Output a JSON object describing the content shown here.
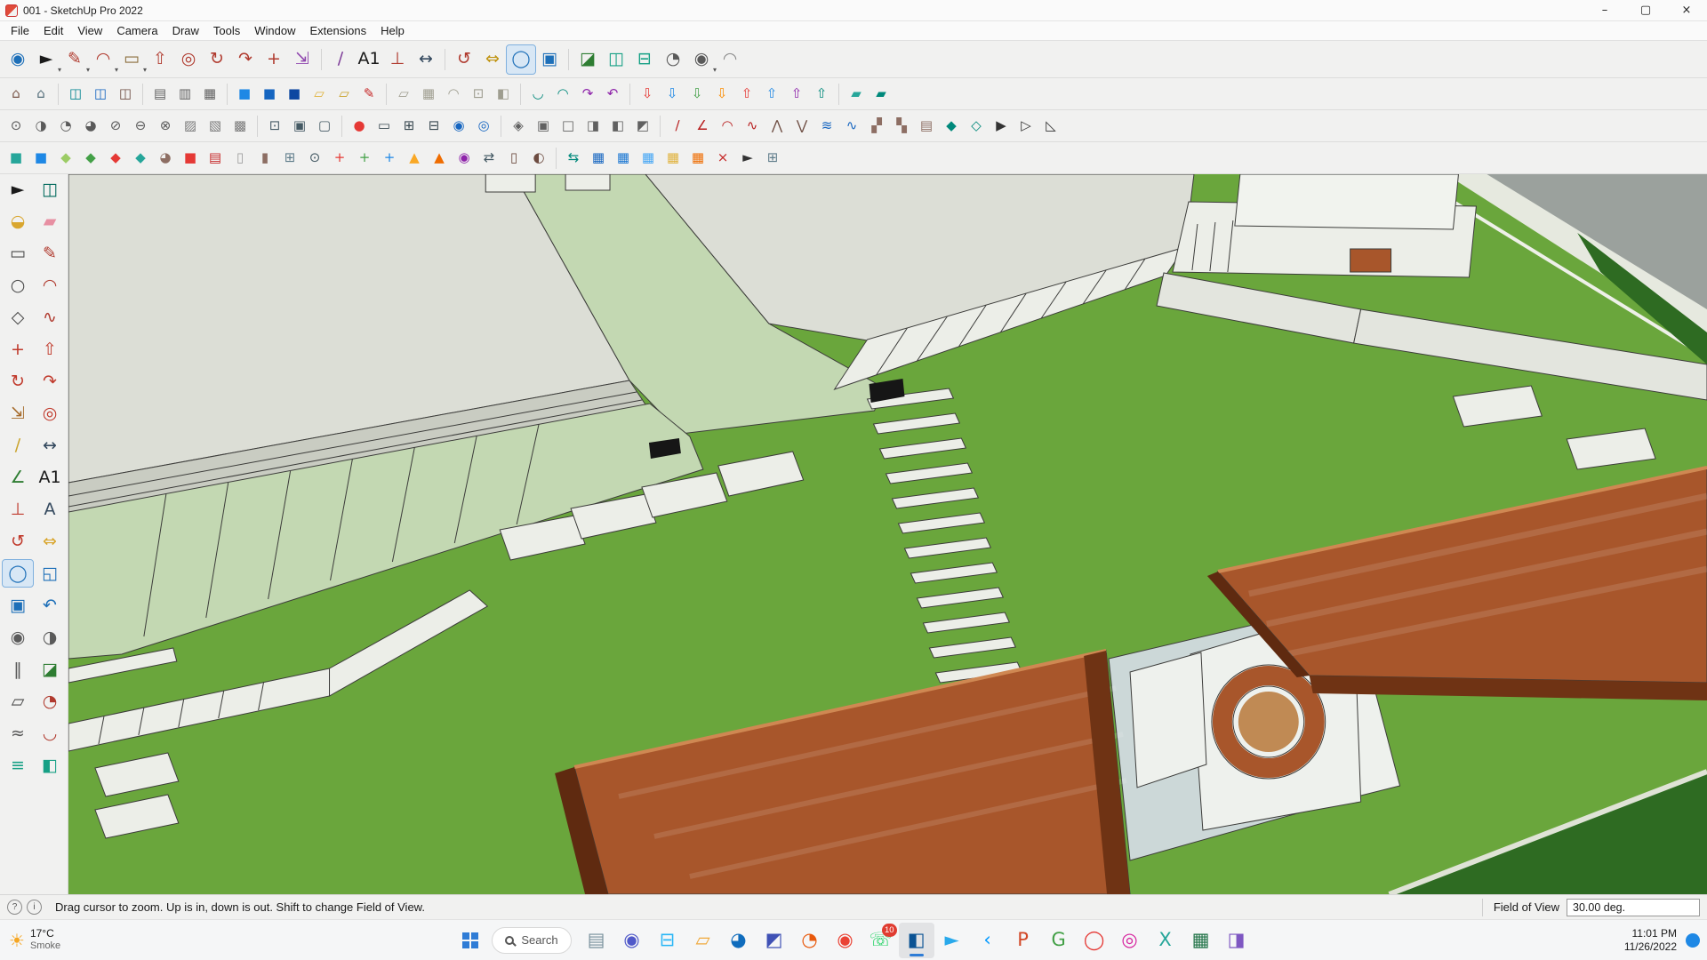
{
  "window": {
    "title": "001 - SketchUp Pro 2022",
    "controls": {
      "minimize": "–",
      "maximize": "▢",
      "close": "×"
    }
  },
  "menu": {
    "items": [
      {
        "n": "menu-file",
        "label": "File"
      },
      {
        "n": "menu-edit",
        "label": "Edit"
      },
      {
        "n": "menu-view",
        "label": "View"
      },
      {
        "n": "menu-camera",
        "label": "Camera"
      },
      {
        "n": "menu-draw",
        "label": "Draw"
      },
      {
        "n": "menu-tools",
        "label": "Tools"
      },
      {
        "n": "menu-window",
        "label": "Window"
      },
      {
        "n": "menu-extensions",
        "label": "Extensions"
      },
      {
        "n": "menu-help",
        "label": "Help"
      }
    ]
  },
  "toolbars": {
    "dropdown_glyph": "▾",
    "row1": [
      {
        "n": "zoom-window-tool",
        "g": "◉",
        "c": "#1d6fb8"
      },
      {
        "n": "select-tool",
        "g": "►",
        "c": "#1a1a1a",
        "dd": true
      },
      {
        "n": "line-tool",
        "g": "✎",
        "c": "#b03a2e",
        "dd": true
      },
      {
        "n": "arc-tool",
        "g": "◠",
        "c": "#b03a2e",
        "dd": true
      },
      {
        "n": "rectangle-tool",
        "g": "▭",
        "c": "#8a6d3b",
        "dd": true
      },
      {
        "n": "push-pull-tool",
        "g": "⇧",
        "c": "#b03a2e"
      },
      {
        "n": "offset-tool",
        "g": "◎",
        "c": "#b03a2e"
      },
      {
        "n": "rotate-tool",
        "g": "↻",
        "c": "#b03a2e"
      },
      {
        "n": "follow-me-tool",
        "g": "↷",
        "c": "#b03a2e"
      },
      {
        "n": "move-tool",
        "g": "+",
        "c": "#b03a2e"
      },
      {
        "n": "scale-tool",
        "g": "⇲",
        "c": "#8e44ad"
      },
      {
        "sep": true
      },
      {
        "n": "tape-measure-tool",
        "g": "∕",
        "c": "#7d3c98"
      },
      {
        "n": "text-tool",
        "g": "A1",
        "c": "#1a1a1a"
      },
      {
        "n": "axes-tool",
        "g": "⊥",
        "c": "#b03a2e"
      },
      {
        "n": "dimension-tool",
        "g": "↔",
        "c": "#34495e"
      },
      {
        "sep": true
      },
      {
        "n": "orbit-tool",
        "g": "↺",
        "c": "#b03a2e"
      },
      {
        "n": "pan-tool",
        "g": "⇔",
        "c": "#c09412"
      },
      {
        "n": "zoom-tool",
        "g": "◯",
        "c": "#1d6fb8",
        "active": true
      },
      {
        "n": "zoom-extents-tool",
        "g": "▣",
        "c": "#1d6fb8"
      },
      {
        "sep": true
      },
      {
        "n": "section-plane-tool",
        "g": "◪",
        "c": "#2e7d32"
      },
      {
        "n": "section-display-toggle",
        "g": "◫",
        "c": "#16a085"
      },
      {
        "n": "section-cut-toggle",
        "g": "⊟",
        "c": "#16a085"
      },
      {
        "n": "search-extensions-icon",
        "g": "◔",
        "c": "#5a5a5a"
      },
      {
        "n": "user-profile-button",
        "g": "◉",
        "c": "#5a5a5a",
        "dd": true
      },
      {
        "n": "look-around-tool",
        "g": "◠",
        "c": "#8a8a8a"
      }
    ],
    "row2": [
      {
        "n": "3d-warehouse-icon",
        "g": "⌂",
        "c": "#795548"
      },
      {
        "n": "extension-warehouse-icon",
        "g": "⌂",
        "c": "#546e7a"
      },
      {
        "sep": true
      },
      {
        "n": "make-component-icon",
        "g": "◫",
        "c": "#00838f"
      },
      {
        "n": "edit-component-icon",
        "g": "◫",
        "c": "#1565c0"
      },
      {
        "n": "lock-component-icon",
        "g": "◫",
        "c": "#6d4c41"
      },
      {
        "sep": true
      },
      {
        "n": "entity-info-panel-icon",
        "g": "▤",
        "c": "#616161"
      },
      {
        "n": "materials-panel-icon",
        "g": "▥",
        "c": "#616161"
      },
      {
        "n": "styles-panel-icon",
        "g": "▦",
        "c": "#616161"
      },
      {
        "sep": true
      },
      {
        "n": "solid-union-icon",
        "g": "■",
        "c": "#1e88e5"
      },
      {
        "n": "solid-subtract-icon",
        "g": "■",
        "c": "#1565c0"
      },
      {
        "n": "solid-intersect-icon",
        "g": "■",
        "c": "#0d47a1"
      },
      {
        "n": "label-icon",
        "g": "▱",
        "c": "#e0b23c"
      },
      {
        "n": "flag-note-icon",
        "g": "▱",
        "c": "#c9a227"
      },
      {
        "n": "marker-icon",
        "g": "✎",
        "c": "#c62828"
      },
      {
        "sep": true
      },
      {
        "n": "sandbox-from-contours-icon",
        "g": "▱",
        "c": "#9e9d8f"
      },
      {
        "n": "sandbox-from-scratch-icon",
        "g": "▦",
        "c": "#9e9d8f"
      },
      {
        "n": "smoove-icon",
        "g": "◠",
        "c": "#9e9d8f"
      },
      {
        "n": "stamp-icon",
        "g": "⊡",
        "c": "#9e9d8f"
      },
      {
        "n": "drape-icon",
        "g": "◧",
        "c": "#9e9d8f"
      },
      {
        "sep": true
      },
      {
        "n": "weld-edges-icon",
        "g": "◡",
        "c": "#00897b"
      },
      {
        "n": "curve-tool-icon",
        "g": "◠",
        "c": "#00897b"
      },
      {
        "n": "follow-path-icon",
        "g": "↷",
        "c": "#8e24aa"
      },
      {
        "n": "reverse-path-icon",
        "g": "↶",
        "c": "#8e24aa"
      },
      {
        "sep": true
      },
      {
        "n": "drop-vertices-red-icon",
        "g": "⇩",
        "c": "#e53935"
      },
      {
        "n": "drop-vertices-blue-icon",
        "g": "⇩",
        "c": "#1e88e5"
      },
      {
        "n": "drop-vertices-green-icon",
        "g": "⇩",
        "c": "#43a047"
      },
      {
        "n": "drop-vertices-orange-icon",
        "g": "⇩",
        "c": "#fb8c00"
      },
      {
        "n": "raise-vertices-red-icon",
        "g": "⇧",
        "c": "#e53935"
      },
      {
        "n": "raise-vertices-blue-icon",
        "g": "⇧",
        "c": "#1e88e5"
      },
      {
        "n": "raise-vertices-purple-icon",
        "g": "⇧",
        "c": "#8e24aa"
      },
      {
        "n": "raise-vertices-teal-icon",
        "g": "⇧",
        "c": "#00897b"
      },
      {
        "sep": true
      },
      {
        "n": "toposhaper-icon",
        "g": "▰",
        "c": "#26a69a"
      },
      {
        "n": "quad-face-tools-icon",
        "g": "▰",
        "c": "#00897b"
      }
    ],
    "row3": [
      {
        "n": "shaded-with-textures-icon",
        "g": "⊙",
        "c": "#5a5a5a"
      },
      {
        "n": "shaded-icon",
        "g": "◑",
        "c": "#5a5a5a"
      },
      {
        "n": "hidden-line-icon",
        "g": "◔",
        "c": "#5a5a5a"
      },
      {
        "n": "wireframe-icon",
        "g": "◕",
        "c": "#5a5a5a"
      },
      {
        "n": "xray-icon",
        "g": "⊘",
        "c": "#5a5a5a"
      },
      {
        "n": "monochrome-icon",
        "g": "⊖",
        "c": "#5a5a5a"
      },
      {
        "n": "back-edges-icon",
        "g": "⊗",
        "c": "#5a5a5a"
      },
      {
        "n": "texture-a-icon",
        "g": "▨",
        "c": "#7a7a7a"
      },
      {
        "n": "texture-b-icon",
        "g": "▧",
        "c": "#7a7a7a"
      },
      {
        "n": "texture-c-icon",
        "g": "▩",
        "c": "#7a7a7a"
      },
      {
        "sep": true
      },
      {
        "n": "shadow-settings-icon",
        "g": "⊡",
        "c": "#455a64"
      },
      {
        "n": "shadows-toggle-icon",
        "g": "▣",
        "c": "#455a64"
      },
      {
        "n": "fog-toggle-icon",
        "g": "▢",
        "c": "#455a64"
      },
      {
        "sep": true
      },
      {
        "n": "scene-record-icon",
        "g": "●",
        "c": "#e53935"
      },
      {
        "n": "monitor-icon",
        "g": "▭",
        "c": "#37474f"
      },
      {
        "n": "film-icon",
        "g": "⊞",
        "c": "#37474f"
      },
      {
        "n": "export-frame-icon",
        "g": "⊟",
        "c": "#37474f"
      },
      {
        "n": "camera-previous-icon",
        "g": "◉",
        "c": "#1565c0"
      },
      {
        "n": "camera-next-icon",
        "g": "◎",
        "c": "#1565c0"
      },
      {
        "sep": true
      },
      {
        "n": "iso-view-icon",
        "g": "◈",
        "c": "#616161"
      },
      {
        "n": "top-view-icon",
        "g": "▣",
        "c": "#616161"
      },
      {
        "n": "front-view-icon",
        "g": "□",
        "c": "#616161"
      },
      {
        "n": "right-view-icon",
        "g": "◨",
        "c": "#616161"
      },
      {
        "n": "back-view-icon",
        "g": "◧",
        "c": "#616161"
      },
      {
        "n": "left-view-icon",
        "g": "◩",
        "c": "#616161"
      },
      {
        "sep": true
      },
      {
        "n": "line-2pt-icon",
        "g": "∕",
        "c": "#b71c1c"
      },
      {
        "n": "angle-tool-icon",
        "g": "∠",
        "c": "#b71c1c"
      },
      {
        "n": "arc-3pt-icon",
        "g": "◠",
        "c": "#b71c1c"
      },
      {
        "n": "bezier-icon",
        "g": "∿",
        "c": "#b71c1c"
      },
      {
        "n": "vertex-edit-icon",
        "g": "⋀",
        "c": "#6d4c41"
      },
      {
        "n": "edge-split-icon",
        "g": "⋁",
        "c": "#6d4c41"
      },
      {
        "n": "waves-icon",
        "g": "≋",
        "c": "#1565c0"
      },
      {
        "n": "contour-icon",
        "g": "∿",
        "c": "#1565c0"
      },
      {
        "n": "hatch-ne-icon",
        "g": "▞",
        "c": "#8d6e63"
      },
      {
        "n": "hatch-nw-icon",
        "g": "▚",
        "c": "#8d6e63"
      },
      {
        "n": "board-icon",
        "g": "▤",
        "c": "#8d6e63"
      },
      {
        "n": "gem-icon",
        "g": "◆",
        "c": "#00897b"
      },
      {
        "n": "gem-outline-icon",
        "g": "◇",
        "c": "#00897b"
      },
      {
        "n": "play-icon",
        "g": "▶",
        "c": "#333333"
      },
      {
        "n": "select-arrow-icon",
        "g": "▷",
        "c": "#333333"
      },
      {
        "n": "wedge-icon",
        "g": "◺",
        "c": "#333333"
      }
    ],
    "row4": [
      {
        "n": "tags-panel-icon",
        "g": "■",
        "c": "#26a69a"
      },
      {
        "n": "outliner-panel-icon",
        "g": "■",
        "c": "#1e88e5"
      },
      {
        "n": "scenes-panel-icon",
        "g": "◆",
        "c": "#9ccc65"
      },
      {
        "n": "instructor-icon",
        "g": "◆",
        "c": "#43a047"
      },
      {
        "n": "settings-diamond-icon",
        "g": "◆",
        "c": "#e53935"
      },
      {
        "n": "preferences-icon",
        "g": "◆",
        "c": "#26a69a"
      },
      {
        "n": "donut-icon",
        "g": "◕",
        "c": "#8d6e63"
      },
      {
        "n": "material-red-icon",
        "g": "■",
        "c": "#e53935"
      },
      {
        "n": "book-icon",
        "g": "▤",
        "c": "#c62828"
      },
      {
        "n": "page-icon",
        "g": "▯",
        "c": "#9e9e9e"
      },
      {
        "n": "wood-sample-icon",
        "g": "▮",
        "c": "#8d6e63"
      },
      {
        "n": "link-icon",
        "g": "⊞",
        "c": "#607d8b"
      },
      {
        "n": "node-edit-icon",
        "g": "⊙",
        "c": "#455a64"
      },
      {
        "n": "add-red-icon",
        "g": "+",
        "c": "#e53935"
      },
      {
        "n": "add-green-icon",
        "g": "+",
        "c": "#43a047"
      },
      {
        "n": "add-blue-icon",
        "g": "+",
        "c": "#1e88e5"
      },
      {
        "n": "pyramid-icon",
        "g": "▲",
        "c": "#f9a825"
      },
      {
        "n": "cone-icon",
        "g": "▲",
        "c": "#ef6c00"
      },
      {
        "n": "droplet-icon",
        "g": "◉",
        "c": "#8e24aa"
      },
      {
        "n": "mirror-icon",
        "g": "⇄",
        "c": "#455a64"
      },
      {
        "n": "bin-icon",
        "g": "▯",
        "c": "#6d4c41"
      },
      {
        "n": "paint-half-icon",
        "g": "◐",
        "c": "#6d4c41"
      },
      {
        "sep": true
      },
      {
        "n": "component-swap-icon",
        "g": "⇆",
        "c": "#00897b"
      },
      {
        "n": "grid-blue-a-icon",
        "g": "▦",
        "c": "#1565c0"
      },
      {
        "n": "grid-blue-b-icon",
        "g": "▦",
        "c": "#1976d2"
      },
      {
        "n": "grid-blue-c-icon",
        "g": "▦",
        "c": "#42a5f5"
      },
      {
        "n": "grid-yellow-icon",
        "g": "▦",
        "c": "#e0b23c"
      },
      {
        "n": "grid-orange-icon",
        "g": "▦",
        "c": "#ef6c00"
      },
      {
        "n": "delete-icon",
        "g": "×",
        "c": "#c62828"
      },
      {
        "n": "cursor-icon",
        "g": "►",
        "c": "#333333"
      },
      {
        "n": "layout-grid-icon",
        "g": "⊞",
        "c": "#607d8b"
      }
    ]
  },
  "palette": [
    {
      "n": "select-tool",
      "g": "►",
      "c": "#1a1a1a"
    },
    {
      "n": "make-component-tool",
      "g": "◫",
      "c": "#00695c"
    },
    {
      "n": "paint-bucket-tool",
      "g": "◒",
      "c": "#d9a62e"
    },
    {
      "n": "eraser-tool",
      "g": "▰",
      "c": "#e78fa2"
    },
    {
      "n": "rectangle-tool",
      "g": "▭",
      "c": "#4a4a4a"
    },
    {
      "n": "line-tool",
      "g": "✎",
      "c": "#b03a2e"
    },
    {
      "n": "circle-tool",
      "g": "○",
      "c": "#4a4a4a"
    },
    {
      "n": "arc-tool",
      "g": "◠",
      "c": "#b03a2e"
    },
    {
      "n": "polygon-tool",
      "g": "◇",
      "c": "#4a4a4a"
    },
    {
      "n": "freehand-tool",
      "g": "∿",
      "c": "#b03a2e"
    },
    {
      "n": "move-tool",
      "g": "+",
      "c": "#c0392b"
    },
    {
      "n": "push-pull-tool",
      "g": "⇧",
      "c": "#c0392b"
    },
    {
      "n": "rotate-tool",
      "g": "↻",
      "c": "#c0392b"
    },
    {
      "n": "follow-me-tool",
      "g": "↷",
      "c": "#c0392b"
    },
    {
      "n": "scale-tool",
      "g": "⇲",
      "c": "#a56a2a"
    },
    {
      "n": "offset-tool",
      "g": "◎",
      "c": "#c0392b"
    },
    {
      "n": "tape-measure-tool",
      "g": "∕",
      "c": "#caa32b"
    },
    {
      "n": "dimension-tool",
      "g": "↔",
      "c": "#34495e"
    },
    {
      "n": "protractor-tool",
      "g": "∠",
      "c": "#2e7d32"
    },
    {
      "n": "text-tool",
      "g": "A1",
      "c": "#1a1a1a"
    },
    {
      "n": "axes-tool",
      "g": "⊥",
      "c": "#c0392b"
    },
    {
      "n": "3d-text-tool",
      "g": "A",
      "c": "#34495e"
    },
    {
      "n": "orbit-tool",
      "g": "↺",
      "c": "#c0392b"
    },
    {
      "n": "pan-tool",
      "g": "⇔",
      "c": "#d9a62e"
    },
    {
      "n": "zoom-tool",
      "g": "◯",
      "c": "#1d6fb8",
      "active": true
    },
    {
      "n": "zoom-window-tool",
      "g": "◱",
      "c": "#1d6fb8"
    },
    {
      "n": "zoom-extents-tool",
      "g": "▣",
      "c": "#1d6fb8"
    },
    {
      "n": "previous-view-tool",
      "g": "↶",
      "c": "#1d6fb8"
    },
    {
      "n": "position-camera-tool",
      "g": "◉",
      "c": "#5a5a5a"
    },
    {
      "n": "look-around-tool",
      "g": "◑",
      "c": "#5a5a5a"
    },
    {
      "n": "walk-tool",
      "g": "‖",
      "c": "#5a5a5a"
    },
    {
      "n": "section-plane-tool",
      "g": "◪",
      "c": "#2e7d32"
    },
    {
      "n": "rotated-rectangle-tool",
      "g": "▱",
      "c": "#4a4a4a"
    },
    {
      "n": "pie-tool",
      "g": "◔",
      "c": "#b03a2e"
    },
    {
      "n": "soften-edges-tool",
      "g": "≈",
      "c": "#5a5a5a"
    },
    {
      "n": "3-point-arc-tool",
      "g": "◡",
      "c": "#b03a2e"
    },
    {
      "n": "tag-tool",
      "g": "≡",
      "c": "#16a085"
    },
    {
      "n": "section-fill-tool",
      "g": "◧",
      "c": "#16a085"
    }
  ],
  "statusbar": {
    "icons": [
      {
        "n": "geolocation-icon",
        "g": "?"
      },
      {
        "n": "credits-info-icon",
        "g": "i"
      }
    ],
    "hint": "Drag cursor to zoom.  Up is in, down is out. Shift to change Field of View.",
    "fov_label": "Field of View",
    "fov_value": "30.00 deg."
  },
  "taskbar": {
    "weather": {
      "glyph": "☀",
      "temp": "17°C",
      "condition": "Smoke"
    },
    "search_placeholder": "Search",
    "apps": [
      {
        "n": "notepad-app-icon",
        "g": "▤",
        "c": "#78909c"
      },
      {
        "n": "teams-app-icon",
        "g": "◉",
        "c": "#5059c9"
      },
      {
        "n": "store-app-icon",
        "g": "⊟",
        "c": "#29b6f6"
      },
      {
        "n": "file-explorer-icon",
        "g": "▱",
        "c": "#f0a93c"
      },
      {
        "n": "edge-browser-icon",
        "g": "◕",
        "c": "#0f6cbd"
      },
      {
        "n": "photos-app-icon",
        "g": "◩",
        "c": "#3f51b5"
      },
      {
        "n": "firefox-browser-icon",
        "g": "◔",
        "c": "#e8590c"
      },
      {
        "n": "chrome-browser-icon",
        "g": "◉",
        "c": "#ea4335"
      },
      {
        "n": "whatsapp-icon",
        "g": "☏",
        "c": "#25d366",
        "b": "10"
      },
      {
        "n": "sketchup-taskbar-icon",
        "g": "◧",
        "c": "#0b5394",
        "active": true
      },
      {
        "n": "telegram-icon",
        "g": "►",
        "c": "#29a9eb"
      },
      {
        "n": "vscode-icon",
        "g": "‹",
        "c": "#0098ff"
      },
      {
        "n": "powerpoint-icon",
        "g": "P",
        "c": "#d24726"
      },
      {
        "n": "gom-app-icon",
        "g": "G",
        "c": "#43a047"
      },
      {
        "n": "opera-browser-icon",
        "g": "◯",
        "c": "#e53935"
      },
      {
        "n": "instagram-icon",
        "g": "◎",
        "c": "#d6249f"
      },
      {
        "n": "xd-app-icon",
        "g": "X",
        "c": "#26a69a"
      },
      {
        "n": "excel-icon",
        "g": "▦",
        "c": "#1e7145"
      },
      {
        "n": "premiere-app-icon",
        "g": "◨",
        "c": "#7e57c2"
      }
    ],
    "tray": {
      "icons": [
        {
          "n": "tray-chevron-icon",
          "g": "^",
          "c": "#333333"
        },
        {
          "n": "onedrive-icon",
          "g": "☁",
          "c": "#546e7a"
        },
        {
          "n": "wifi-icon",
          "g": "≋",
          "c": "#333333"
        },
        {
          "n": "volume-icon",
          "g": "◁)",
          "c": "#333333"
        }
      ],
      "time": "11:01 PM",
      "date": "11/26/2022"
    }
  },
  "scene": {
    "colors": {
      "grass": "#6aa63c",
      "concrete": "#dcded6",
      "concretedark": "#c9ccc2",
      "pathgreen": "#c3d8b2",
      "slab": "#eceee8",
      "slab2": "#e3e5de",
      "road": "#9ba19d",
      "curb": "#e6e9df",
      "line": "#3c3c3a",
      "roof": "#a8562b",
      "roofdark": "#6f3314",
      "roofhi": "#cf8852",
      "wall": "#eef1ed",
      "interior": "#ccd8d8",
      "hedge": "#2e6b22",
      "ringwood": "#c08a54",
      "cube": "#161616"
    }
  }
}
